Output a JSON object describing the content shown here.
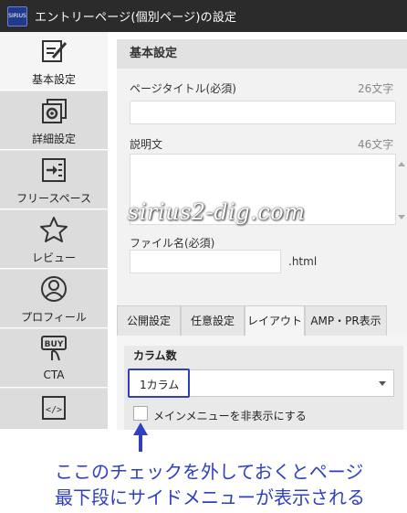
{
  "window": {
    "title": "エントリーページ(個別ページ)の設定",
    "icon": "app-icon"
  },
  "sidebar": {
    "items": [
      {
        "label": "基本設定",
        "icon": "edit-icon",
        "active": true
      },
      {
        "label": "詳細設定",
        "icon": "settings-icon",
        "active": false
      },
      {
        "label": "フリースペース",
        "icon": "login-arrow-icon",
        "active": false
      },
      {
        "label": "レビュー",
        "icon": "star-icon",
        "active": false
      },
      {
        "label": "プロフィール",
        "icon": "user-icon",
        "active": false
      },
      {
        "label": "CTA",
        "icon": "buy-icon",
        "active": false
      },
      {
        "label": "",
        "icon": "code-icon",
        "active": false
      }
    ]
  },
  "panel": {
    "heading": "基本設定",
    "page_title": {
      "label": "ページタイトル(必須)",
      "counter": "26文字",
      "value": ""
    },
    "description": {
      "label": "説明文",
      "counter": "46文字",
      "value": ""
    },
    "file_name": {
      "label": "ファイル名(必須)",
      "value": "",
      "suffix": ".html"
    }
  },
  "watermark": "sirius2-dig.com",
  "tabs": [
    {
      "label": "公開設定",
      "active": false
    },
    {
      "label": "任意設定",
      "active": false
    },
    {
      "label": "レイアウト",
      "active": true
    },
    {
      "label": "AMP・PR表示",
      "active": false
    }
  ],
  "layout": {
    "column_title": "カラム数",
    "column_select": "1カラム",
    "hide_menu_label": "メインメニューを非表示にする",
    "hide_menu_checked": false
  },
  "annotation": {
    "line1": "ここのチェックを外しておくとページ",
    "line2": "最下段にサイドメニューが表示される",
    "color": "#2f3fbf"
  }
}
